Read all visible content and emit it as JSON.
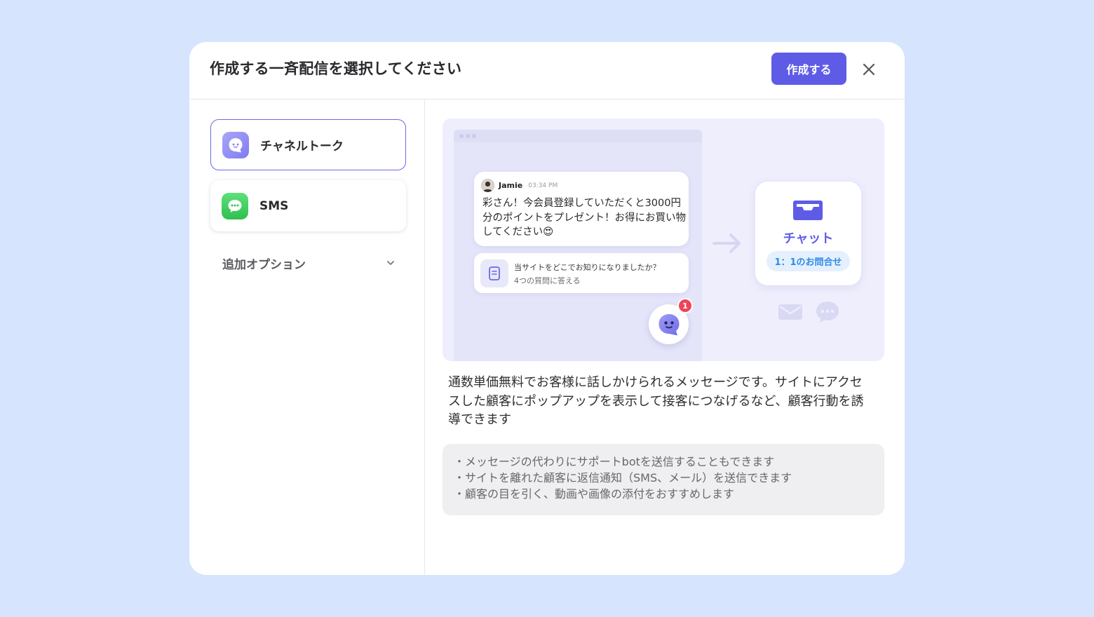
{
  "dialog": {
    "title": "作成する一斉配信を選択してください",
    "create_label": "作成する",
    "close_icon": "close-icon"
  },
  "options": [
    {
      "label": "チャネルトーク",
      "icon": "channel-talk-icon",
      "selected": true,
      "color": "#8f8cf5"
    },
    {
      "label": "SMS",
      "icon": "sms-bubble-icon",
      "selected": false,
      "color": "#34c759"
    }
  ],
  "extra_options": {
    "label": "追加オプション",
    "icon": "chevron-down-icon"
  },
  "preview": {
    "message": {
      "sender": "Jamie",
      "time": "03:34 PM",
      "text": "彩さん！今会員登録していただくと3000円分のポイントをプレゼント！お得にお買い物してください😍"
    },
    "survey": {
      "question": "当サイトをどこでお知りになりましたか？",
      "subtitle": "4つの質問に答える"
    },
    "launcher_badge": "1",
    "chat_card": {
      "title": "チャット",
      "pill": "1：1のお問合せ"
    }
  },
  "description": "通数単価無料でお客様に話しかけられるメッセージです。サイトにアクセスした顧客にポップアップを表示して接客につなげるなど、顧客行動を誘導できます",
  "notes": [
    "・メッセージの代わりにサポートbotを送信することもできます",
    "・サイトを離れた顧客に返信通知（SMS、メール）を送信できます",
    "・顧客の目を引く、動画や画像の添付をおすすめします"
  ],
  "colors": {
    "background": "#d6e4fd",
    "accent": "#5e5ce6",
    "badge": "#f04458",
    "pill_text": "#2f8ae6"
  }
}
